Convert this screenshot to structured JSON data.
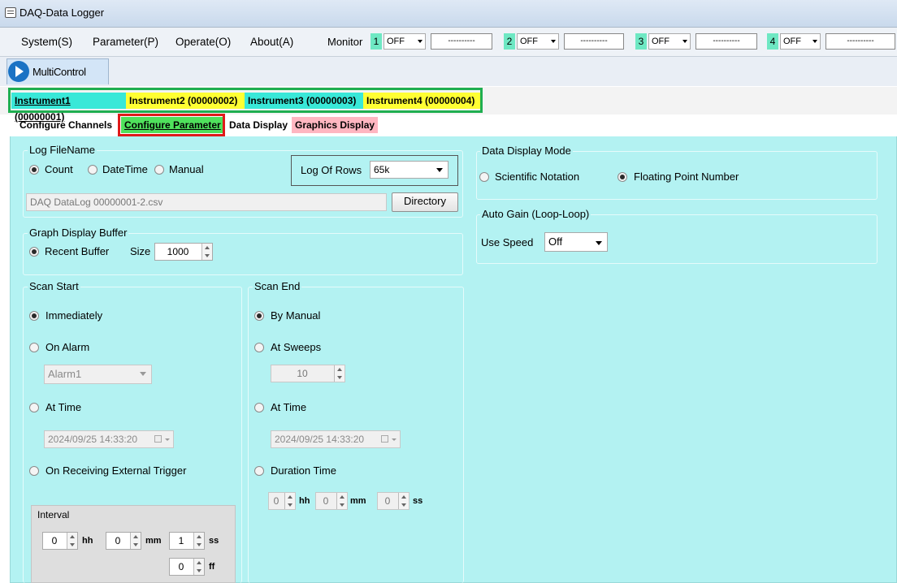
{
  "window": {
    "title": "DAQ-Data Logger"
  },
  "menu": {
    "system": "System(S)",
    "parameter": "Parameter(P)",
    "operate": "Operate(O)",
    "about": "About(A)"
  },
  "monitor": {
    "label": "Monitor",
    "channels": [
      {
        "num": "1",
        "state": "OFF",
        "value": "----------"
      },
      {
        "num": "2",
        "state": "OFF",
        "value": "----------"
      },
      {
        "num": "3",
        "state": "OFF",
        "value": "----------"
      },
      {
        "num": "4",
        "state": "OFF",
        "value": "----------"
      }
    ],
    "num_color": "#6ee8c3"
  },
  "toolbar": {
    "multicontrol": "MultiControl"
  },
  "instruments": [
    {
      "label": "Instrument1 (00000001)",
      "color": "#39e8d8"
    },
    {
      "label": "Instrument2 (00000002)",
      "color": "#ffff33"
    },
    {
      "label": "Instrument3 (00000003)",
      "color": "#39e8d8"
    },
    {
      "label": "Instrument4 (00000004)",
      "color": "#ffff33"
    }
  ],
  "subtabs": {
    "configure_channels": "Configure Channels",
    "configure_parameter": "Configure Parameter",
    "data_display": "Data Display",
    "graphics_display": "Graphics Display"
  },
  "log_filename": {
    "title": "Log FileName",
    "options": [
      "Count",
      "DateTime",
      "Manual"
    ],
    "selected": "Count",
    "rows_label": "Log Of Rows",
    "rows_value": "65k",
    "path": "DAQ DataLog 00000001-2.csv",
    "directory_button": "Directory"
  },
  "graph_buffer": {
    "title": "Graph Display Buffer",
    "recent": "Recent Buffer",
    "size_label": "Size",
    "size_value": "1000"
  },
  "scan_start": {
    "title": "Scan Start",
    "immediately": "Immediately",
    "on_alarm": "On Alarm",
    "alarm_value": "Alarm1",
    "at_time": "At Time",
    "time_value": "2024/09/25 14:33:20",
    "external": "On Receiving External Trigger",
    "selected": "Immediately"
  },
  "interval": {
    "title": "Interval",
    "hh": "0",
    "hh_unit": "hh",
    "mm": "0",
    "mm_unit": "mm",
    "ss": "1",
    "ss_unit": "ss",
    "ff": "0",
    "ff_unit": "ff"
  },
  "scan_end": {
    "title": "Scan End",
    "by_manual": "By Manual",
    "at_sweeps": "At Sweeps",
    "sweeps_value": "10",
    "at_time": "At Time",
    "time_value": "2024/09/25 14:33:20",
    "duration": "Duration Time",
    "hh": "0",
    "hh_unit": "hh",
    "mm": "0",
    "mm_unit": "mm",
    "ss": "0",
    "ss_unit": "ss",
    "selected": "By Manual"
  },
  "data_display_mode": {
    "title": "Data Display Mode",
    "scientific": "Scientific Notation",
    "floating": "Floating Point Number",
    "selected": "Floating Point Number"
  },
  "auto_gain": {
    "title": "Auto Gain (Loop-Loop)",
    "use_speed": "Use Speed",
    "speed_value": "Off"
  },
  "colors": {
    "panel": "#b3f2f2",
    "instrument_box": "#1fae50",
    "parameter_box": "#e01a1a",
    "configure_parameter_tab": "#4fe15c",
    "graphics_tab": "#ffb6c1"
  }
}
